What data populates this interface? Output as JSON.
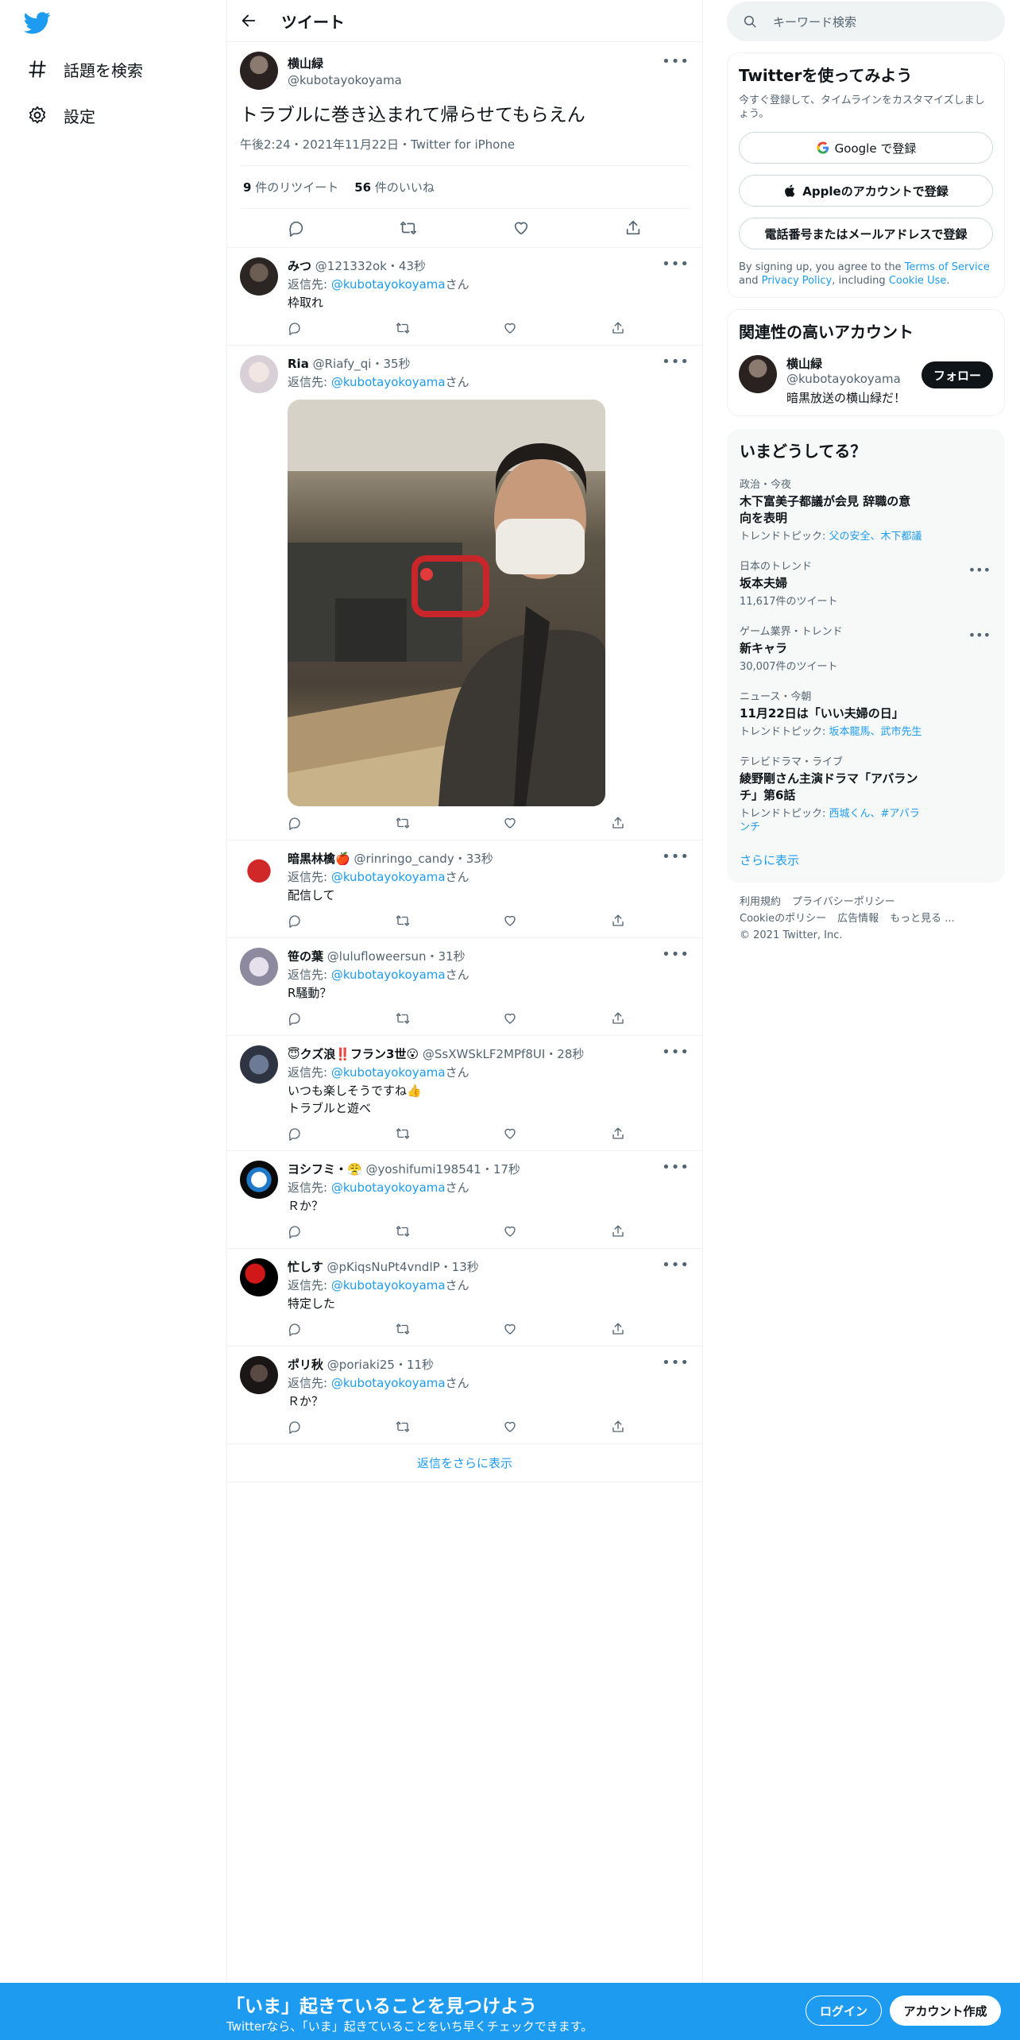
{
  "nav": {
    "explore_label": "話題を検索",
    "settings_label": "設定"
  },
  "header": {
    "title": "ツイート"
  },
  "focal_tweet": {
    "name": "横山緑",
    "handle": "@kubotayokoyama",
    "text": "トラブルに巻き込まれて帰らせてもらえん",
    "meta": "午後2:24・2021年11月22日・Twitter for iPhone",
    "retweets_count": "9",
    "retweets_label": " 件のリツイート",
    "likes_count": "56",
    "likes_label": " 件のいいね"
  },
  "reply_prefix": "返信先: ",
  "reply_suffix": "さん",
  "replies": [
    {
      "name": "みつ",
      "handle": "@121332ok",
      "time": "・43秒",
      "to": "@kubotayokoyama",
      "text": "枠取れ"
    },
    {
      "name": "Ria",
      "handle": "@Riafy_qi",
      "time": "・35秒",
      "to": "@kubotayokoyama",
      "text": ""
    },
    {
      "name": "暗黒林檎🍎",
      "handle": "@rinringo_candy",
      "time": "・33秒",
      "to": "@kubotayokoyama",
      "text": "配信して"
    },
    {
      "name": "笹の葉",
      "handle": "@lulufloweersun",
      "time": "・31秒",
      "to": "@kubotayokoyama",
      "text": "R騒動？"
    },
    {
      "name": "😇クズ浪‼️フラン3世😮",
      "handle": "@SsXWSkLF2MPf8UI",
      "time": "・28秒",
      "to": "@kubotayokoyama",
      "text": "いつも楽しそうですね👍\nトラブルと遊べ"
    },
    {
      "name": "ヨシフミ・😤",
      "handle": "@yoshifumi198541",
      "time": "・17秒",
      "to": "@kubotayokoyama",
      "text": "Ｒか？"
    },
    {
      "name": "忙しす",
      "handle": "@pKiqsNuPt4vndlP",
      "time": "・13秒",
      "to": "@kubotayokoyama",
      "text": "特定した"
    },
    {
      "name": "ポリ秋",
      "handle": "@poriaki25",
      "time": "・11秒",
      "to": "@kubotayokoyama",
      "text": "Ｒか？"
    }
  ],
  "show_more_replies": "返信をさらに表示",
  "search": {
    "placeholder": "キーワード検索"
  },
  "signup_card": {
    "title": "Twitterを使ってみよう",
    "subtitle": "今すぐ登録して、タイムラインをカスタマイズしましょう。",
    "google_btn": "Google で登録",
    "apple_btn": "Appleのアカウントで登録",
    "phone_btn": "電話番号またはメールアドレスで登録",
    "terms_1": "By signing up, you agree to the ",
    "terms_link1": "Terms of Service",
    "terms_2": " and ",
    "terms_link2": "Privacy Policy",
    "terms_3": ", including ",
    "terms_link3": "Cookie Use",
    "terms_4": "."
  },
  "related": {
    "title": "関連性の高いアカウント",
    "name": "横山緑",
    "handle": "@kubotayokoyama",
    "bio": "暗黒放送の横山緑だ！",
    "follow_label": "フォロー"
  },
  "trends": {
    "title": "いまどうしてる？",
    "items": [
      {
        "ctx": "政治・今夜",
        "title": "木下富美子都議が会見 辞職の意向を表明",
        "count_prefix": "トレンドトピック: ",
        "count_link": "父の安全、木下都議"
      },
      {
        "ctx": "日本のトレンド",
        "title": "坂本夫婦",
        "count_prefix": "11,617件のツイート",
        "count_link": ""
      },
      {
        "ctx": "ゲーム業界・トレンド",
        "title": "新キャラ",
        "count_prefix": "30,007件のツイート",
        "count_link": ""
      },
      {
        "ctx": "ニュース・今朝",
        "title": "11月22日は「いい夫婦の日」",
        "count_prefix": "トレンドトピック: ",
        "count_link": "坂本龍馬、武市先生"
      },
      {
        "ctx": "テレビドラマ・ライブ",
        "title": "綾野剛さん主演ドラマ「アバランチ」第6話",
        "count_prefix": "トレンドトピック: ",
        "count_link": "西城くん、#アバランチ"
      }
    ],
    "show_more": "さらに表示"
  },
  "footer": {
    "terms": "利用規約",
    "privacy": "プライバシーポリシー",
    "cookie": "Cookieのポリシー",
    "ads": "広告情報",
    "more": "もっと見る ...",
    "copyright": "© 2021 Twitter, Inc."
  },
  "bottom_bar": {
    "title": "「いま」起きていることを見つけよう",
    "subtitle": "Twitterなら、「いま」起きていることをいち早くチェックできます。",
    "login": "ログイン",
    "signup": "アカウント作成"
  },
  "colors": {
    "brand": "#1d9bf0",
    "text": "#0f1419",
    "muted": "#536471"
  }
}
